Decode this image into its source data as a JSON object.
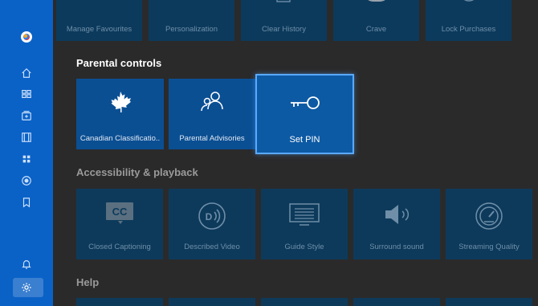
{
  "sidebar": {
    "items": [
      {
        "name": "home-icon"
      },
      {
        "name": "guide-icon"
      },
      {
        "name": "recordings-icon"
      },
      {
        "name": "movies-icon"
      },
      {
        "name": "apps-icon"
      },
      {
        "name": "live-icon"
      },
      {
        "name": "bookmark-icon"
      },
      {
        "name": "notifications-icon"
      },
      {
        "name": "settings-icon",
        "active": true
      }
    ],
    "accent": "#0a62c7"
  },
  "top_row": {
    "items": [
      {
        "label": "Manage Favourites"
      },
      {
        "label": "Personalization"
      },
      {
        "label": "Clear History"
      },
      {
        "label": "Crave"
      },
      {
        "label": "Lock Purchases"
      }
    ]
  },
  "parental_controls": {
    "title": "Parental controls",
    "items": [
      {
        "label": "Canadian Classificatio..",
        "icon": "maple-leaf-icon"
      },
      {
        "label": "Parental Advisories",
        "icon": "people-icon"
      },
      {
        "label": "Set PIN",
        "icon": "key-icon",
        "selected": true
      }
    ]
  },
  "accessibility": {
    "title": "Accessibility & playback",
    "items": [
      {
        "label": "Closed Captioning",
        "icon": "cc-icon"
      },
      {
        "label": "Described Video",
        "icon": "described-video-icon"
      },
      {
        "label": "Guide Style",
        "icon": "keyboard-icon"
      },
      {
        "label": "Surround sound",
        "icon": "speaker-icon"
      },
      {
        "label": "Streaming Quality",
        "icon": "gauge-icon"
      }
    ]
  },
  "help": {
    "title": "Help"
  }
}
